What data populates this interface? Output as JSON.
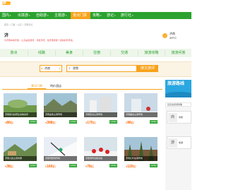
{
  "brand": {
    "logo_text": "游"
  },
  "nav": {
    "items": [
      {
        "label": "国内"
      },
      {
        "label": "出境游"
      },
      {
        "label": "自助游"
      },
      {
        "label": "主题游"
      },
      {
        "label": "景点门票"
      },
      {
        "label": "攻略"
      },
      {
        "label": "游记"
      },
      {
        "label": "旅行社"
      }
    ],
    "active_index": 4
  },
  "breadcrumb": "首页 > 门票 > 山东 > 济南景点",
  "header": {
    "title": "济",
    "subtitle": "为济南本地宇宙... 山东是您游览... 市区风景，给济南旅游一道新的风景线。"
  },
  "weather": {
    "line1": "济南",
    "line2": "3/9°C"
  },
  "tabs": [
    {
      "label": "景点"
    },
    {
      "label": "线路"
    },
    {
      "label": "美食"
    },
    {
      "label": "住宿"
    },
    {
      "label": "交通"
    },
    {
      "label": "旅游攻略"
    },
    {
      "label": "旅游问答"
    }
  ],
  "search": {
    "city_value": "济南",
    "query_value": "滑雪",
    "button_label": "搜文搜评"
  },
  "list_tabs": [
    {
      "label": "景点门票"
    },
    {
      "label": "特价酒店"
    }
  ],
  "cards": [
    {
      "label": "济南跑马岭野生动物世界",
      "price": "80",
      "buy": "立即预订"
    },
    {
      "label": "济南金象山滑雪场",
      "price": "398",
      "buy": "立即预订"
    },
    {
      "label": "济南卧虎山滑雪场",
      "price": "170",
      "buy": "立即预订"
    },
    {
      "label": "济南蟠龙山滑雪场",
      "price": "96",
      "buy": "立即预订"
    },
    {
      "label": "济南九如山瀑布群",
      "price": "38",
      "buy": "立即预订"
    },
    {
      "label": "济南雪野滑雪场",
      "price": "160",
      "buy": "立即预订"
    },
    {
      "label": "济南滑雪训练基地",
      "price": "78",
      "buy": "立即预订"
    },
    {
      "label": "济南红叶谷滑雪场",
      "price": "120",
      "buy": "立即预订"
    }
  ],
  "promo": {
    "title": "旅游路线"
  },
  "side": {
    "header": "您身边旅游攻略",
    "btn1": {
      "icon": "商",
      "label": "商旅"
    },
    "btn2": {
      "icon": "游",
      "label": "旅游"
    }
  }
}
